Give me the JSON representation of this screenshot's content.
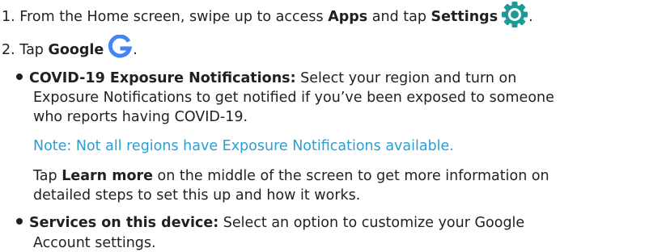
{
  "steps": [
    {
      "number": "1.",
      "text_before": "From the Home screen, swipe up to access ",
      "apps": "Apps",
      "text_middle": " and tap ",
      "settings": "Settings",
      "text_after": ".",
      "icon": "settings-gear-icon",
      "icon_color": "#1e9a96"
    },
    {
      "number": "2.",
      "text_before": "Tap ",
      "google": "Google",
      "text_after": ".",
      "icon": "google-g-icon",
      "icon_color": "#4285f4"
    }
  ],
  "bullets": [
    {
      "title": "COVID-19 Exposure Notifications:",
      "line1": " Select your region and turn on",
      "line2": "Exposure Notifications to get notified if you’ve been exposed to someone",
      "line3": "who reports having COVID-19."
    },
    {
      "title": "Services on this device:",
      "line1": " Select an option to customize your Google",
      "line2": "Account settings."
    }
  ],
  "note": {
    "text": "Note: Not all regions have Exposure Notifications available.",
    "color": "#2a9fd6"
  },
  "learn_more": {
    "before": "Tap ",
    "bold": "Learn more",
    "after": " on the middle of the screen to get more information on",
    "line2": "detailed steps to set this up and how it works."
  }
}
